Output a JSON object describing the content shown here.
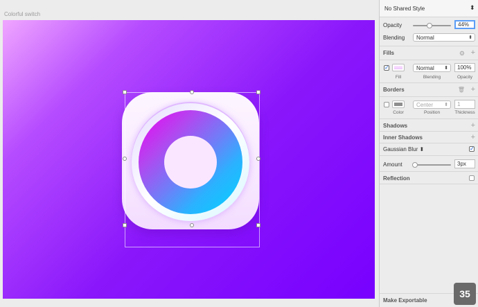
{
  "artboard": {
    "title": "Colorful switch"
  },
  "inspector": {
    "shared_style": "No Shared Style",
    "opacity": {
      "label": "Opacity",
      "value": "44%",
      "level": 0.44
    },
    "blending": {
      "label": "Blending",
      "value": "Normal"
    },
    "fills": {
      "title": "Fills",
      "mode": "Normal",
      "opacity": "100%",
      "cap_fill": "Fill",
      "cap_blending": "Blending",
      "cap_opacity": "Opacity",
      "checked": true,
      "color": "#eec8ff"
    },
    "borders": {
      "title": "Borders",
      "position": "Center",
      "thickness": "1",
      "cap_color": "Color",
      "cap_position": "Position",
      "cap_thickness": "Thickness",
      "checked": false,
      "color": "#8e8e8e"
    },
    "shadows": {
      "title": "Shadows"
    },
    "inner_shadows": {
      "title": "Inner Shadows"
    },
    "gaussian_blur": {
      "title": "Gaussian Blur",
      "checked": true
    },
    "amount": {
      "label": "Amount",
      "value": "3px",
      "level": 0.06
    },
    "reflection": {
      "title": "Reflection",
      "checked": false
    },
    "make_exportable": "Make Exportable"
  },
  "badge": "35",
  "colors": {
    "accent": "#5b9df6",
    "artboard_gradient_start": "#f0a6ff",
    "artboard_gradient_end": "#7700ff"
  },
  "icons": {
    "gear": "gear-icon",
    "trash": "trash-icon",
    "plus": "plus-icon",
    "stepper": "stepper-icon"
  }
}
